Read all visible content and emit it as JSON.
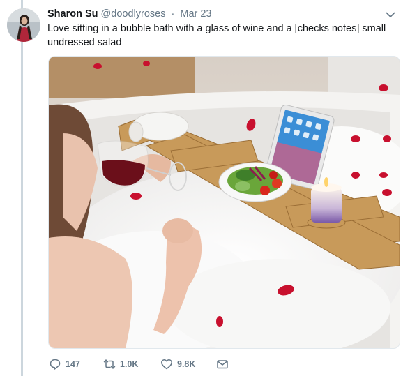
{
  "tweet": {
    "author_name": "Sharon Su",
    "author_handle": "@doodlyroses",
    "separator": "·",
    "timestamp": "Mar 23",
    "text": "Love sitting in a bubble bath with a glass of wine and a [checks notes] small undressed salad"
  },
  "actions": {
    "replies": "147",
    "retweets": "1.0K",
    "likes": "9.8K"
  },
  "icons": {
    "reply": "reply-icon",
    "retweet": "retweet-icon",
    "like": "heart-icon",
    "dm": "envelope-icon",
    "menu": "chevron-down-icon"
  },
  "colors": {
    "text_primary": "#14171a",
    "text_secondary": "#657786",
    "thread_line": "#ccd6dd",
    "border": "#e1e8ed"
  }
}
